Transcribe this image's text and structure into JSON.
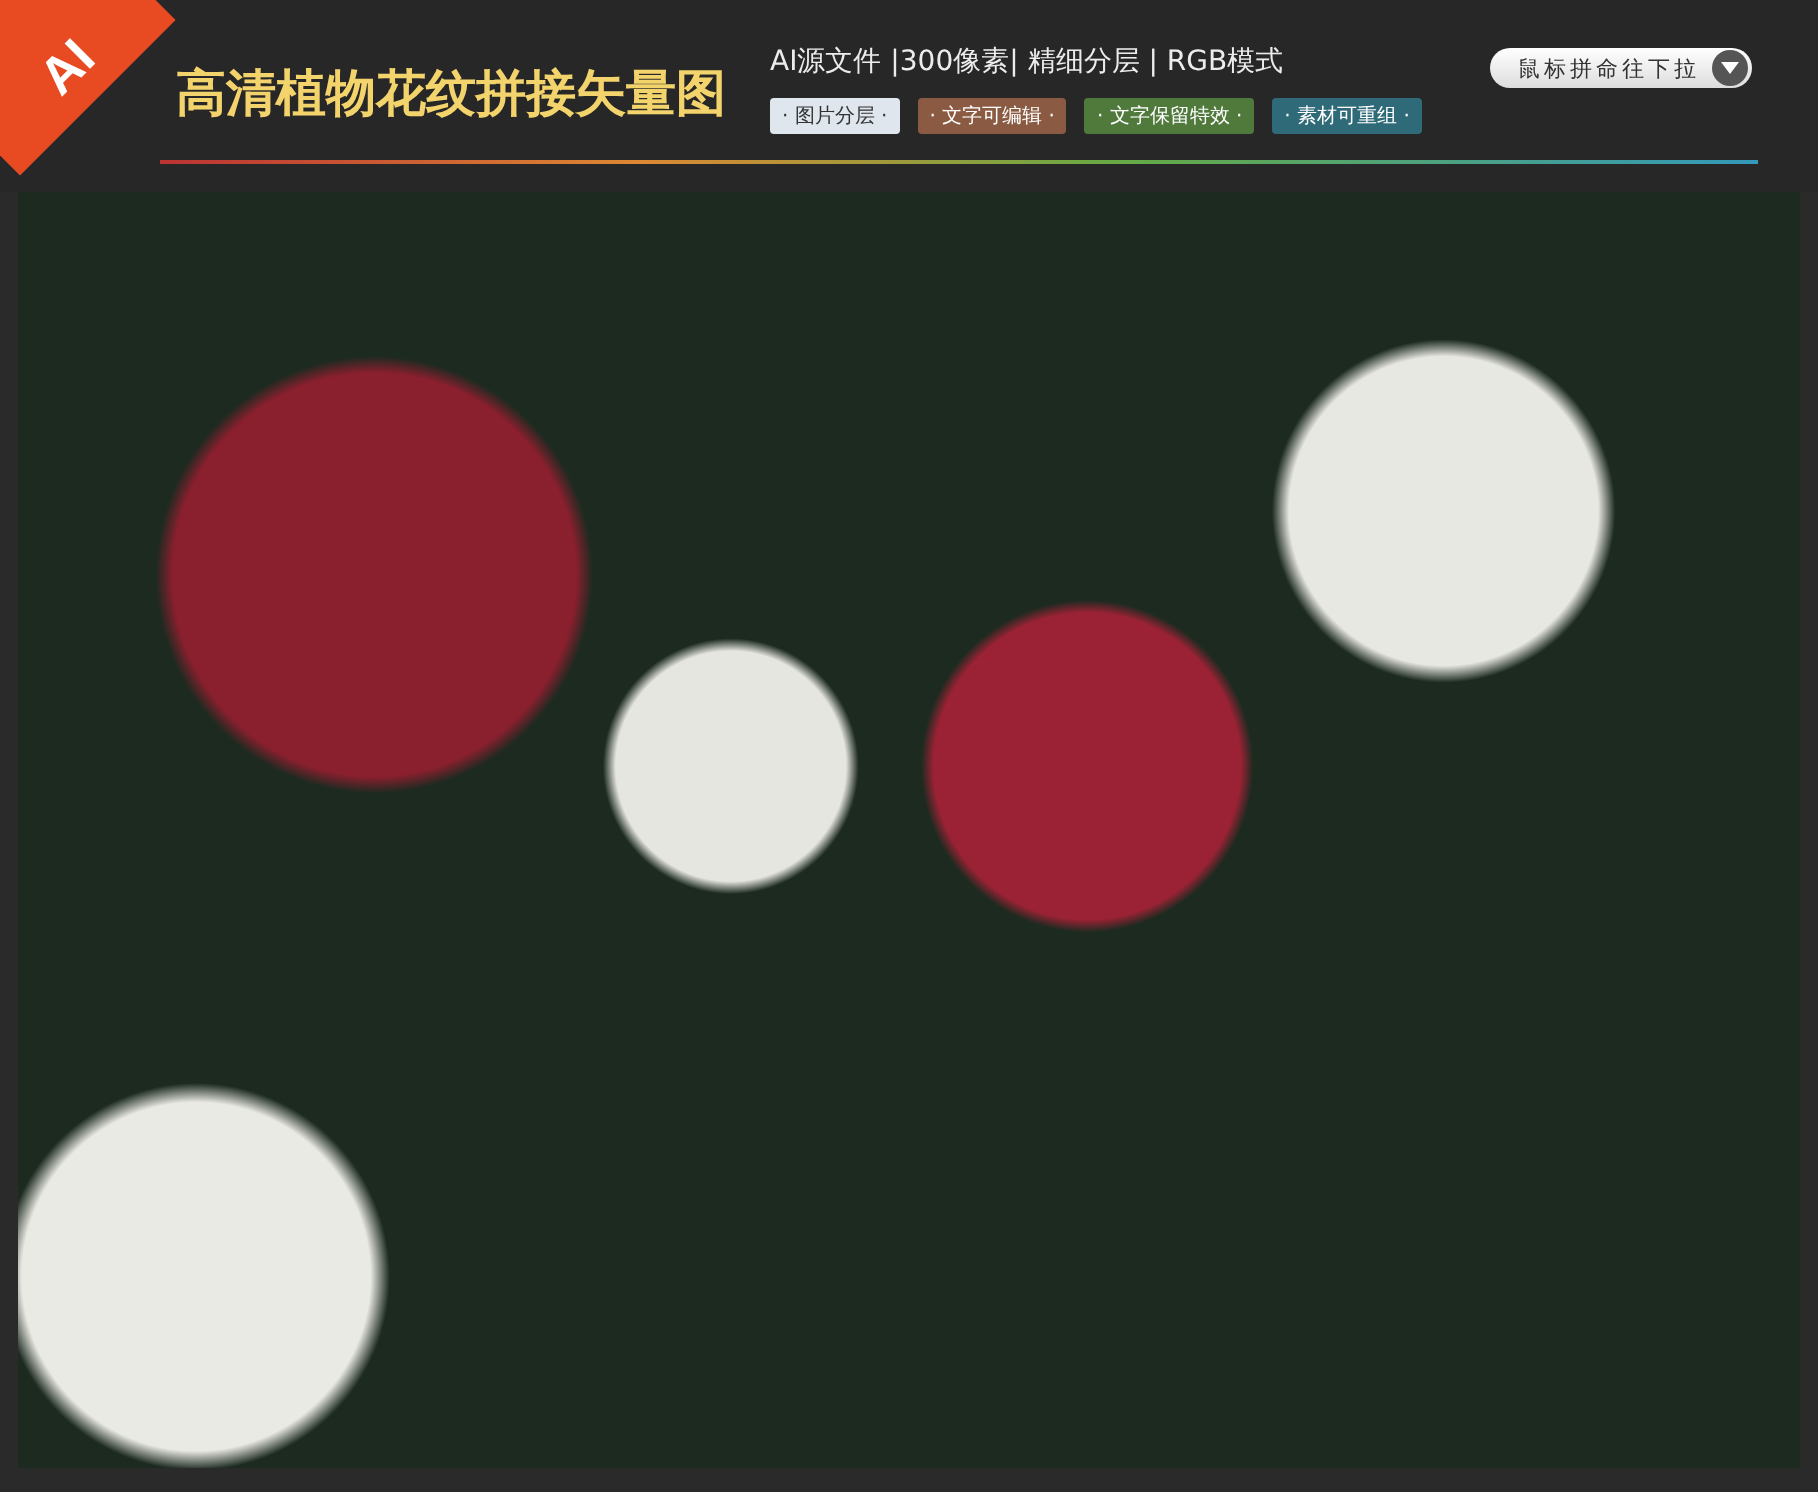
{
  "badge": "AI",
  "title": "高清植物花纹拼接矢量图",
  "specs": "AI源文件 |300像素| 精细分层 | RGB模式",
  "scroll_hint": {
    "label": "鼠标拼命往下拉"
  },
  "tags": [
    {
      "label": "· 图片分层 ·",
      "color": "#dfe6ee"
    },
    {
      "label": "· 文字可编辑 ·",
      "color": "#8a5a42"
    },
    {
      "label": "· 文字保留特效 ·",
      "color": "#4f7a3c"
    },
    {
      "label": "· 素材可重组 ·",
      "color": "#2f6a78"
    }
  ]
}
